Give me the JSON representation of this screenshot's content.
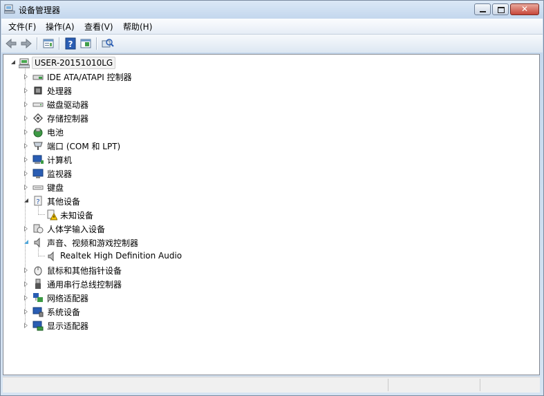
{
  "window": {
    "title": "设备管理器",
    "minimize_label": "",
    "maximize_label": "",
    "close_label": "✕"
  },
  "menu": [
    {
      "label": "文件(F)"
    },
    {
      "label": "操作(A)"
    },
    {
      "label": "查看(V)"
    },
    {
      "label": "帮助(H)"
    }
  ],
  "toolbar": {
    "icons": [
      "back-arrow-icon",
      "forward-arrow-icon",
      "properties-icon",
      "help-icon",
      "toggle-pane-icon",
      "scan-hardware-icon"
    ]
  },
  "tree": {
    "root": "USER-20151010LG",
    "nodes": [
      {
        "label": "IDE ATA/ATAPI 控制器",
        "icon": "ide-controller-icon"
      },
      {
        "label": "处理器",
        "icon": "processor-icon"
      },
      {
        "label": "磁盘驱动器",
        "icon": "disk-drive-icon"
      },
      {
        "label": "存储控制器",
        "icon": "storage-controller-icon"
      },
      {
        "label": "电池",
        "icon": "battery-icon"
      },
      {
        "label": "端口 (COM 和 LPT)",
        "icon": "port-icon"
      },
      {
        "label": "计算机",
        "icon": "computer-icon"
      },
      {
        "label": "监视器",
        "icon": "monitor-icon"
      },
      {
        "label": "键盘",
        "icon": "keyboard-icon"
      },
      {
        "label": "其他设备",
        "icon": "other-devices-icon",
        "children": [
          {
            "label": "未知设备",
            "icon": "unknown-device-warning-icon"
          }
        ]
      },
      {
        "label": "人体学输入设备",
        "icon": "hid-icon"
      },
      {
        "label": "声音、视频和游戏控制器",
        "icon": "speaker-icon",
        "children": [
          {
            "label": "Realtek High Definition Audio",
            "icon": "speaker-icon"
          }
        ]
      },
      {
        "label": "鼠标和其他指针设备",
        "icon": "mouse-icon"
      },
      {
        "label": "通用串行总线控制器",
        "icon": "usb-icon"
      },
      {
        "label": "网络适配器",
        "icon": "network-adapter-icon"
      },
      {
        "label": "系统设备",
        "icon": "system-device-icon"
      },
      {
        "label": "显示适配器",
        "icon": "display-adapter-icon"
      }
    ]
  }
}
